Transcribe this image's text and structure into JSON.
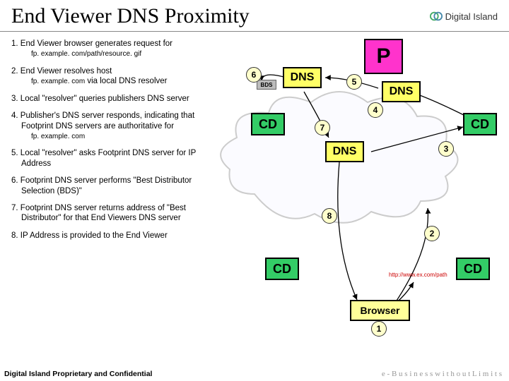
{
  "title": "End Viewer DNS Proximity",
  "brand": "Digital Island",
  "steps": [
    {
      "num": "1.",
      "text": "End Viewer browser generates request for",
      "mono": "fp. example. com/path/resource. gif"
    },
    {
      "num": "2.",
      "text_a": "End Viewer resolves host",
      "mono": "fp. example. com",
      "text_b": " via local DNS resolver"
    },
    {
      "num": "3.",
      "text": "Local \"resolver\" queries publishers DNS server"
    },
    {
      "num": "4.",
      "text": "Publisher's DNS server responds, indicating that Footprint DNS servers are authoritative for",
      "mono": "fp. example. com"
    },
    {
      "num": "5.",
      "text": "Local \"resolver\" asks Footprint DNS server for IP Address"
    },
    {
      "num": "6.",
      "text": "Footprint DNS server performs \"Best Distributor Selection (BDS)\""
    },
    {
      "num": "7.",
      "text": "Footprint DNS server returns address of \"Best Distributor\" for that End Viewers DNS server"
    },
    {
      "num": "8.",
      "text": "IP Address is provided to the End Viewer"
    }
  ],
  "diagram": {
    "p_label": "P",
    "dns_label": "DNS",
    "cd_label": "CD",
    "browser_label": "Browser",
    "bds_label": "BDS",
    "url": "http://www.ex.com/path",
    "numbers": [
      "1",
      "2",
      "3",
      "4",
      "5",
      "6",
      "7",
      "8"
    ]
  },
  "footer": "Digital Island Proprietary and Confidential",
  "tagline": "e - B u s i n e s s   w i t h o u t   L i m i t s"
}
